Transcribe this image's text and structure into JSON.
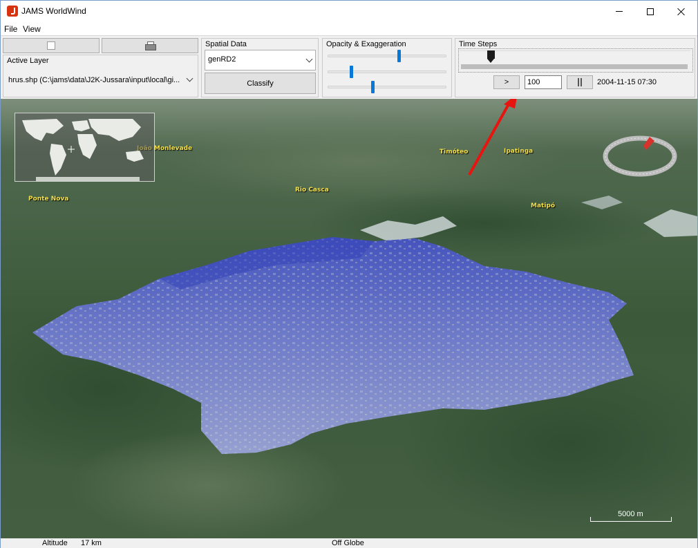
{
  "window": {
    "title": "JAMS WorldWind"
  },
  "menu": [
    {
      "label": "File"
    },
    {
      "label": "View"
    }
  ],
  "layer_panel": {
    "title": "Active Layer",
    "active_layer": "hrus.shp (C:\\jams\\data\\J2K-Jussara\\input\\local\\gi..."
  },
  "spatial_panel": {
    "title": "Spatial Data",
    "selected": "genRD2",
    "classify_label": "Classify"
  },
  "opacity_panel": {
    "title": "Opacity & Exaggeration",
    "sliders": [
      {
        "name": "opacity",
        "value": 0.6
      },
      {
        "name": "exaggeration",
        "value": 0.2
      },
      {
        "name": "third",
        "value": 0.38
      }
    ]
  },
  "timesteps_panel": {
    "title": "Time Steps",
    "slider_value": 0.13,
    "play_label": ">",
    "step_value": "100",
    "pause_label": "||",
    "datetime": "2004-11-15 07:30"
  },
  "globe": {
    "places": [
      {
        "label": "João Monlevade"
      },
      {
        "label": "Timóteo"
      },
      {
        "label": "Ipatinga"
      },
      {
        "label": "Rio Casca"
      },
      {
        "label": "Ponte Nova"
      },
      {
        "label": "Matipó"
      }
    ],
    "scale_label": "5000 m",
    "compass_color": "#d9322a",
    "overlay_color": "#5a68c8",
    "annotation_arrow_color": "#e8140f"
  },
  "status": {
    "altitude_label": "Altitude",
    "altitude_value": "17 km",
    "position": "Off Globe"
  }
}
